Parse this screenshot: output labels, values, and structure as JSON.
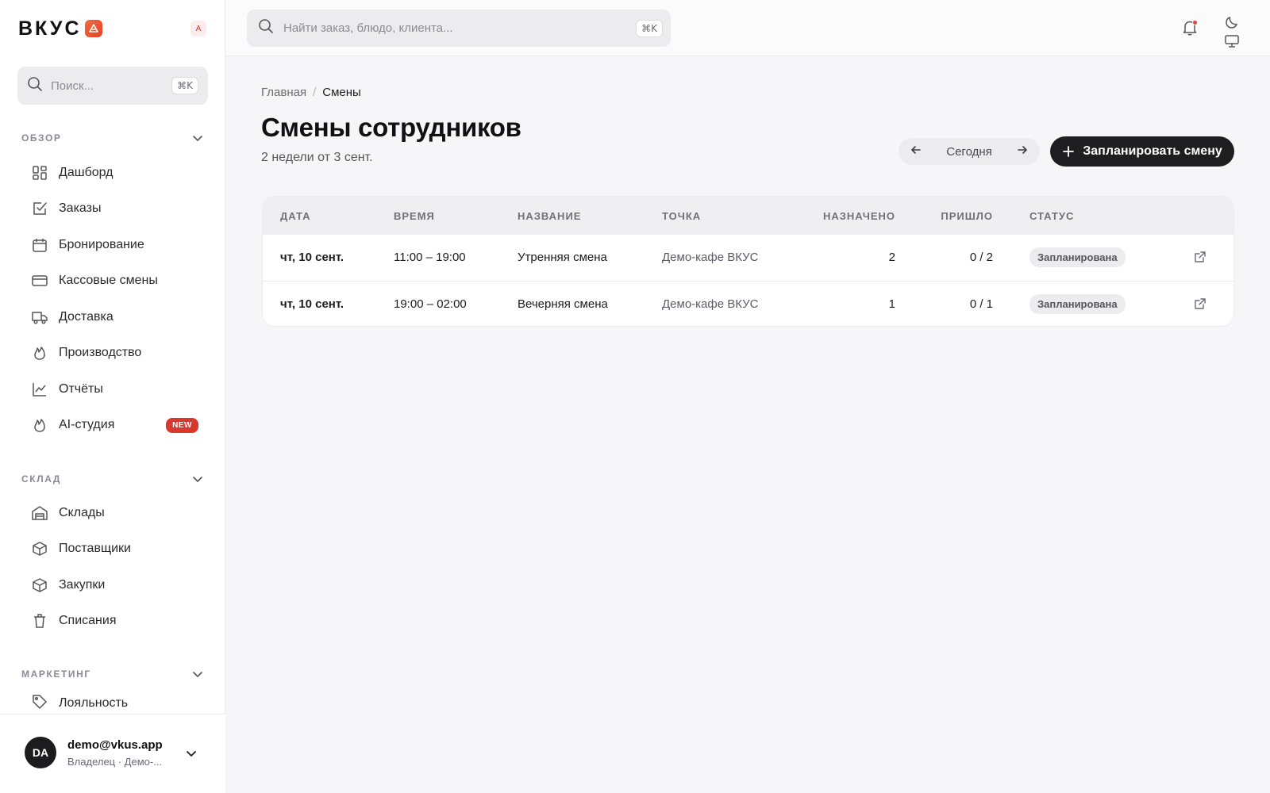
{
  "brand": {
    "name": "ВКУС",
    "mini_avatar": "A",
    "accent": "#e5412a"
  },
  "sidebar": {
    "search_placeholder": "Поиск...",
    "search_shortcut": "⌘K",
    "sections": [
      {
        "label": "ОБЗОР"
      },
      {
        "label": "СКЛАД"
      },
      {
        "label": "МАРКЕТИНГ"
      }
    ],
    "items": [
      {
        "label": "Дашборд",
        "icon": "grid-icon"
      },
      {
        "label": "Заказы",
        "icon": "checkbox-icon"
      },
      {
        "label": "Бронирование",
        "icon": "calendar-icon"
      },
      {
        "label": "Кассовые смены",
        "icon": "card-icon"
      },
      {
        "label": "Доставка",
        "icon": "truck-icon"
      },
      {
        "label": "Производство",
        "icon": "flame-icon"
      },
      {
        "label": "Отчёты",
        "icon": "chart-icon"
      },
      {
        "label": "AI-студия",
        "icon": "flame-icon",
        "badge": "NEW"
      },
      {
        "label": "Склады",
        "icon": "warehouse-icon"
      },
      {
        "label": "Поставщики",
        "icon": "box-icon"
      },
      {
        "label": "Закупки",
        "icon": "box-icon"
      },
      {
        "label": "Списания",
        "icon": "trash-icon"
      },
      {
        "label": "Лояльность",
        "icon": "tag-icon"
      }
    ],
    "user": {
      "initials": "DA",
      "email": "demo@vkus.app",
      "role": "Владелец · Демо-..."
    }
  },
  "topbar": {
    "search_placeholder": "Найти заказ, блюдо, клиента...",
    "search_shortcut": "⌘K"
  },
  "breadcrumb": {
    "home": "Главная",
    "separator": "/",
    "current": "Смены"
  },
  "page": {
    "title": "Смены сотрудников",
    "subtitle": "2 недели от 3 сент.",
    "today_label": "Сегодня",
    "add_button": "Запланировать смену"
  },
  "table": {
    "headers": [
      "ДАТА",
      "ВРЕМЯ",
      "НАЗВАНИЕ",
      "ТОЧКА",
      "НАЗНАЧЕНО",
      "ПРИШЛО",
      "СТАТУС"
    ],
    "rows": [
      {
        "date": "чт, 10 сент.",
        "time": "11:00 – 19:00",
        "name": "Утренняя смена",
        "location": "Демо-кафе ВКУС",
        "assigned": "2",
        "arrived": "0 / 2",
        "status": "Запланирована"
      },
      {
        "date": "чт, 10 сент.",
        "time": "19:00 – 02:00",
        "name": "Вечерняя смена",
        "location": "Демо-кафе ВКУС",
        "assigned": "1",
        "arrived": "0 / 1",
        "status": "Запланирована"
      }
    ]
  }
}
